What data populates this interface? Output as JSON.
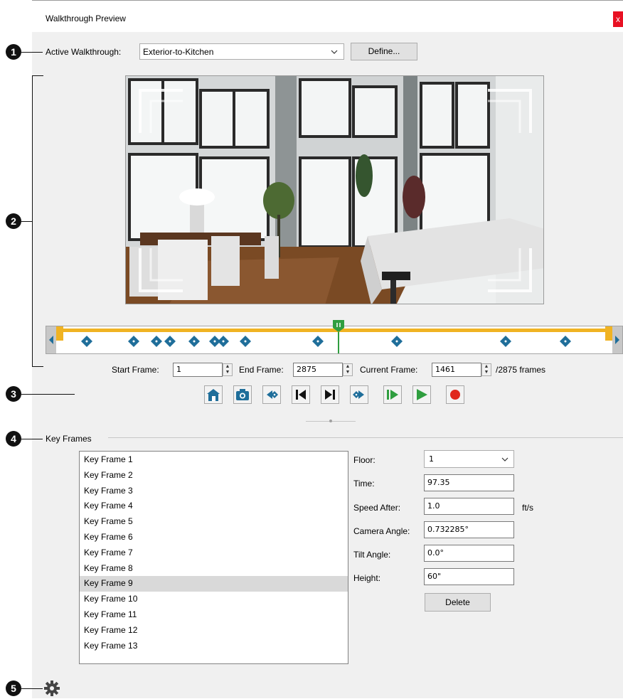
{
  "window": {
    "title": "Walkthrough Preview",
    "close_label": "x"
  },
  "callouts": [
    "1",
    "2",
    "3",
    "4",
    "5"
  ],
  "walkthrough": {
    "label": "Active Walkthrough:",
    "value": "Exterior-to-Kitchen",
    "define_label": "Define..."
  },
  "frames": {
    "start_label": "Start Frame:",
    "start_value": "1",
    "end_label": "End Frame:",
    "end_value": "2875",
    "current_label": "Current Frame:",
    "current_value": "1461",
    "total_text": "/2875 frames"
  },
  "timeline": {
    "total_frames": 2875,
    "current_frame": 1461,
    "key_frame_positions": [
      0.055,
      0.14,
      0.18,
      0.205,
      0.248,
      0.285,
      0.3,
      0.34,
      0.47,
      0.612,
      0.808,
      0.915
    ],
    "track_color": "#f0b323",
    "marker_color": "#1f6e9a",
    "playhead_color": "#2f9e3f"
  },
  "toolbar": [
    {
      "name": "home-icon"
    },
    {
      "name": "camera-icon"
    },
    {
      "name": "previous-key-frame-icon"
    },
    {
      "name": "skip-to-start-icon"
    },
    {
      "name": "skip-to-end-icon"
    },
    {
      "name": "next-key-frame-icon"
    },
    {
      "name": "play-from-start-icon"
    },
    {
      "name": "play-icon"
    },
    {
      "name": "record-icon"
    }
  ],
  "key_frames": {
    "heading": "Key Frames",
    "items": [
      "Key Frame 1",
      "Key Frame 2",
      "Key Frame 3",
      "Key Frame 4",
      "Key Frame 5",
      "Key Frame 6",
      "Key Frame 7",
      "Key Frame 8",
      "Key Frame 9",
      "Key Frame 10",
      "Key Frame 11",
      "Key Frame 12",
      "Key Frame 13"
    ],
    "selected_index": 8
  },
  "props": {
    "floor_label": "Floor:",
    "floor_value": "1",
    "time_label": "Time:",
    "time_value": "97.35",
    "speed_label": "Speed After:",
    "speed_value": "1.0",
    "speed_unit": "ft/s",
    "camera_label": "Camera Angle:",
    "camera_value": "0.732285°",
    "tilt_label": "Tilt Angle:",
    "tilt_value": "0.0°",
    "height_label": "Height:",
    "height_value": "60\"",
    "delete_label": "Delete"
  },
  "footer": {
    "settings_icon": "gear-icon"
  }
}
